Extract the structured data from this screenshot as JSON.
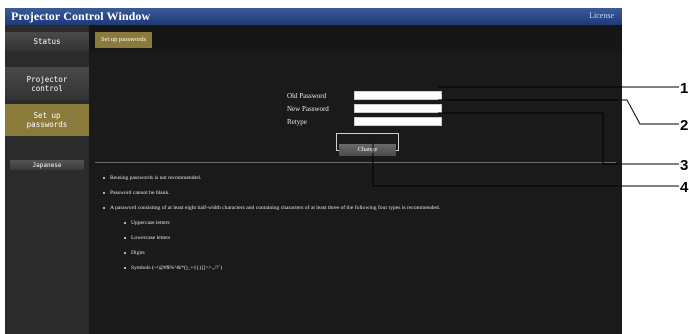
{
  "app": {
    "title": "Projector Control Window",
    "license_label": "License"
  },
  "sidebar": {
    "items": [
      {
        "label": "Status"
      },
      {
        "label": "Projector\ncontrol"
      },
      {
        "label": "Set up\npasswords"
      },
      {
        "label": "Japanese"
      }
    ]
  },
  "tabs": {
    "active_label": "Set up passwords"
  },
  "form": {
    "old_password_label": "Old Password",
    "new_password_label": "New Password",
    "retype_label": "Retype",
    "old_password_value": "",
    "new_password_value": "",
    "retype_value": "",
    "change_label": "Change"
  },
  "notes": {
    "items": [
      "Reusing passwords is not recommended.",
      "Password cannot be blank.",
      "A password consisting of at least eight half-width characters and containing characters of at least three of the following four types is recommended."
    ],
    "subitems": [
      "Uppercase letters",
      "Lowercase letters",
      "Digits",
      "Symbols (~!@#$%^&*()_+|\\{}[]<>.,/?`)"
    ]
  },
  "callouts": [
    "1",
    "2",
    "3",
    "4"
  ],
  "colors": {
    "title_bar": "#1e3a78",
    "active_accent": "#8a7a3c",
    "background": "#111111"
  }
}
